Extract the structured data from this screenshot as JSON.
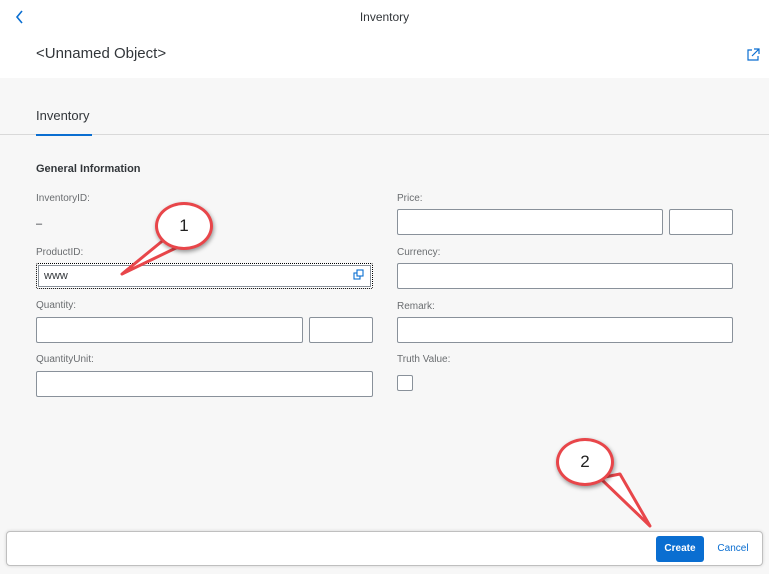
{
  "shell": {
    "title": "Inventory"
  },
  "header": {
    "object_title": "<Unnamed Object>"
  },
  "tabs": [
    {
      "label": "Inventory",
      "selected": true
    }
  ],
  "form": {
    "section_title": "General Information",
    "inventory_id": {
      "label": "InventoryID:",
      "value": "–"
    },
    "product_id": {
      "label": "ProductID:",
      "value": "www"
    },
    "quantity": {
      "label": "Quantity:",
      "value": "",
      "unit_value": ""
    },
    "quantity_unit": {
      "label": "QuantityUnit:",
      "value": ""
    },
    "price": {
      "label": "Price:",
      "value": "",
      "currency_value": ""
    },
    "currency": {
      "label": "Currency:",
      "value": ""
    },
    "remark": {
      "label": "Remark:",
      "value": ""
    },
    "truth_value": {
      "label": "Truth Value:",
      "checked": false
    }
  },
  "footer": {
    "create_label": "Create",
    "cancel_label": "Cancel"
  },
  "callouts": [
    {
      "number": "1"
    },
    {
      "number": "2"
    }
  ],
  "icons": {
    "back": "chevron-left-icon",
    "share": "share-icon",
    "value_help": "value-help-icon"
  },
  "colors": {
    "accent": "#0a6ed1",
    "callout_border": "#e8464a",
    "background": "#f7f7f7"
  }
}
